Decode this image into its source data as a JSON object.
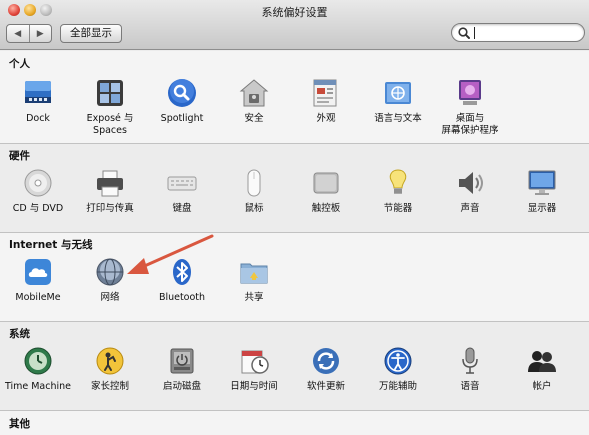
{
  "window": {
    "title": "系统偏好设置",
    "show_all": "全部显示",
    "back_glyph": "◀",
    "forward_glyph": "▶",
    "search_value": ""
  },
  "sections": [
    {
      "title": "个人",
      "items": [
        {
          "label": "Dock",
          "icon": "dock-icon"
        },
        {
          "label": "Exposé 与\nSpaces",
          "icon": "expose-spaces-icon"
        },
        {
          "label": "Spotlight",
          "icon": "spotlight-icon"
        },
        {
          "label": "安全",
          "icon": "security-icon"
        },
        {
          "label": "外观",
          "icon": "appearance-icon"
        },
        {
          "label": "语言与文本",
          "icon": "language-text-icon"
        },
        {
          "label": "桌面与\n屏幕保护程序",
          "icon": "desktop-screensaver-icon"
        }
      ]
    },
    {
      "title": "硬件",
      "items": [
        {
          "label": "CD 与 DVD",
          "icon": "cd-dvd-icon"
        },
        {
          "label": "打印与传真",
          "icon": "print-fax-icon"
        },
        {
          "label": "键盘",
          "icon": "keyboard-icon"
        },
        {
          "label": "鼠标",
          "icon": "mouse-icon"
        },
        {
          "label": "触控板",
          "icon": "trackpad-icon"
        },
        {
          "label": "节能器",
          "icon": "energy-saver-icon"
        },
        {
          "label": "声音",
          "icon": "sound-icon"
        },
        {
          "label": "显示器",
          "icon": "displays-icon"
        }
      ]
    },
    {
      "title": "Internet 与无线",
      "items": [
        {
          "label": "MobileMe",
          "icon": "mobileme-icon"
        },
        {
          "label": "网络",
          "icon": "network-icon"
        },
        {
          "label": "Bluetooth",
          "icon": "bluetooth-icon"
        },
        {
          "label": "共享",
          "icon": "sharing-icon"
        }
      ]
    },
    {
      "title": "系统",
      "items": [
        {
          "label": "Time Machine",
          "icon": "time-machine-icon"
        },
        {
          "label": "家长控制",
          "icon": "parental-controls-icon"
        },
        {
          "label": "启动磁盘",
          "icon": "startup-disk-icon"
        },
        {
          "label": "日期与时间",
          "icon": "date-time-icon"
        },
        {
          "label": "软件更新",
          "icon": "software-update-icon"
        },
        {
          "label": "万能辅助",
          "icon": "universal-access-icon"
        },
        {
          "label": "语音",
          "icon": "speech-icon"
        },
        {
          "label": "帐户",
          "icon": "accounts-icon"
        }
      ]
    },
    {
      "title": "其他",
      "items": []
    }
  ],
  "colors": {
    "arrow": "#d9573f",
    "accent": "#3a78d6"
  }
}
